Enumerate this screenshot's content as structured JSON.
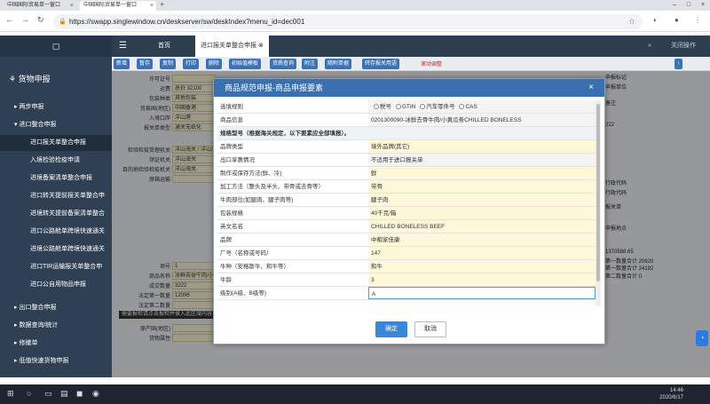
{
  "browser": {
    "tabs": [
      {
        "label": "中国国际贸易单一窗口"
      },
      {
        "label": "中国国际贸易单一窗口"
      }
    ],
    "url": "https://swapp.singlewindow.cn/deskserver/sw/deskIndex?menu_id=dec001"
  },
  "sidebar": {
    "title": "货物申报",
    "items": [
      {
        "label": "两步申报"
      },
      {
        "label": "进口整合申报"
      },
      {
        "label": "进口报关单整合申报"
      },
      {
        "label": "入境检验检疫申请"
      },
      {
        "label": "进境备案清单整合申报"
      },
      {
        "label": "进口转关提前报关单整合申"
      },
      {
        "label": "进境转关提前备案清单整合"
      },
      {
        "label": "进口公路舱单跨境快速通关"
      },
      {
        "label": "进境公路舱单跨境快速通关"
      },
      {
        "label": "进口TIR运输报关单整合申"
      },
      {
        "label": "进口公自用物品申报"
      },
      {
        "label": "出口整合申报"
      },
      {
        "label": "数据查询/统计"
      },
      {
        "label": "修撤单"
      },
      {
        "label": "低值快速货物申报"
      }
    ]
  },
  "topnav": {
    "home": "首页",
    "tab": "进口报关单整合申报",
    "right": "关闭操作"
  },
  "toolbar": {
    "buttons": [
      "新增",
      "暂存",
      "复制",
      "打印",
      "删除",
      "初始值模板",
      "资质查询",
      "附注",
      "随附单据",
      "转存报关用语"
    ],
    "red": "滚动调整"
  },
  "background": {
    "labels": [
      "许可证号",
      "运费",
      "包装种类",
      "贸易国(地区)",
      "入境口岸",
      "报关单类型",
      "检验检疫受理机关",
      "领证机关",
      "目的地检验检疫机关",
      "原箱运输"
    ],
    "values": [
      "",
      "总价 32100",
      "其他包装",
      "中国香港",
      "洋山港",
      "通关无纸化",
      "洋山海关 / 洋山港",
      "洋山海关",
      "洋山海关",
      ""
    ],
    "goods_labels": [
      "项号",
      "商品名称",
      "成交数量",
      "法定第一数量",
      "法定第二数量",
      "原产国(地区)",
      "货物属性"
    ],
    "goods_values": [
      "1",
      "冰鲜去骨牛肉/小黄瓜条",
      "3222",
      "12096",
      "",
      "",
      ""
    ],
    "right_values": [
      "申报标记",
      "申报单位",
      "备注",
      "222",
      "行政代码",
      "行政代码",
      "报关单",
      "申报地点",
      "1370588.65",
      "第一数量合计 20620",
      "第一数量合计 24192",
      "第二数量合计 0"
    ],
    "tooltip": "需要报检请点击报检并录入此区域内容"
  },
  "modal": {
    "title": "商品规范申报-商品申报要素",
    "select_rule_label": "选填规则",
    "radio_options": [
      "税号",
      "GTIN",
      "汽车零件号",
      "CAS"
    ],
    "goods_info_label": "商品信息",
    "goods_info_value": "0201300090-冰鲜去骨牛肉/小黄瓜条CHILLED BONELESS",
    "note": "规格型号（根据海关规定，以下要素应全部填报）。",
    "rows": [
      {
        "label": "品牌类型",
        "value": "境外品牌(其它)"
      },
      {
        "label": "出口享惠情况",
        "value": "不适用于进口报关单"
      },
      {
        "label": "制作或保存方法(鲜、冷)",
        "value": "鲜"
      },
      {
        "label": "加工方法（整头及半头、带骨或去骨等）",
        "value": "带骨"
      },
      {
        "label": "牛肉部位(如腿肉、腱子肉等)",
        "value": "腱子肉"
      },
      {
        "label": "包装规格",
        "value": "40千克/箱"
      },
      {
        "label": "英文名名",
        "value": "CHILLED BONELESS BEEF"
      },
      {
        "label": "品牌",
        "value": "中粮家佳康"
      },
      {
        "label": "厂号（名称或号码）",
        "value": "147"
      },
      {
        "label": "牛种（安格斯牛、和牛等）",
        "value": "和牛"
      },
      {
        "label": "牛龄",
        "value": "3"
      },
      {
        "label": "级别(A级、B级等)",
        "value": "A"
      }
    ],
    "ok": "确定",
    "cancel": "取消"
  },
  "taskbar": {
    "time": "14:46",
    "date": "2020/6/17"
  }
}
